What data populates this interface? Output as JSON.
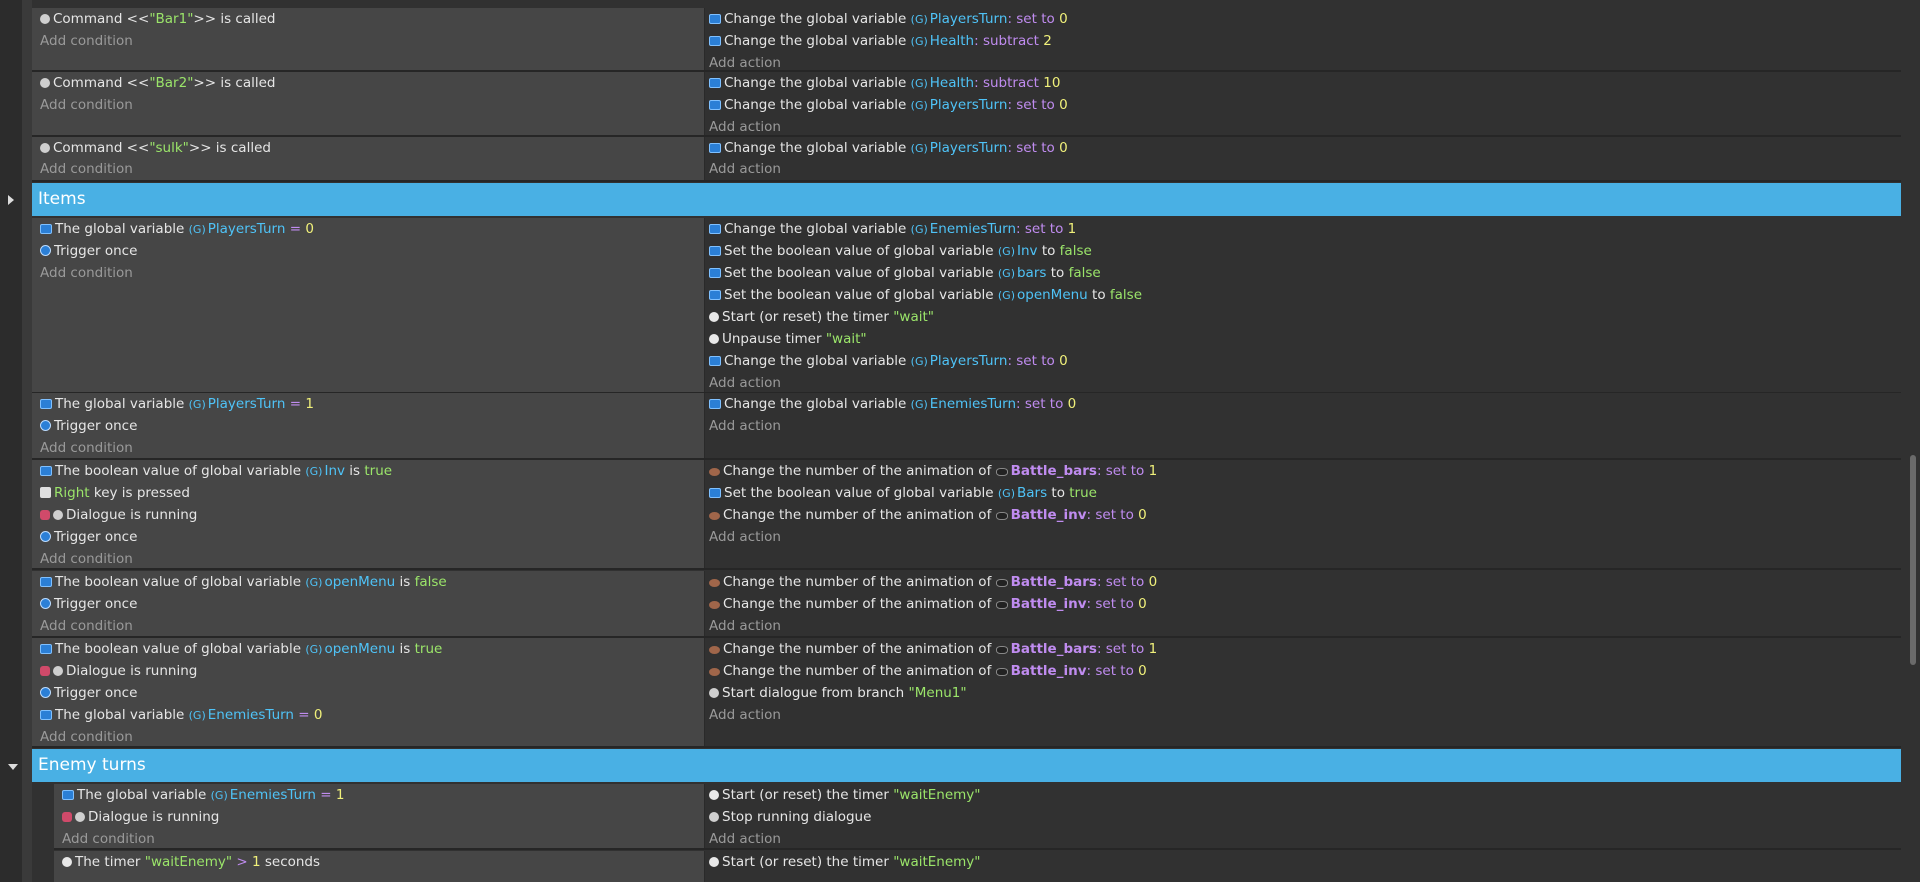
{
  "common": {
    "add_condition": "Add condition",
    "add_action": "Add action",
    "change_gv": "Change the global variable",
    "set_to": ": set to",
    "subtract": ": subtract",
    "the_gv": "The global variable",
    "trigger_once": "Trigger once",
    "bool_gv": "The boolean value of global variable",
    "set_bool": "Set the boolean value of global variable",
    "change_anim": "Change the number of the animation of",
    "is": "is",
    "to": "to",
    "dialogue_running": "Dialogue is running",
    "start_timer": "Start (or reset) the timer",
    "cmd_pre": "Command <<",
    "cmd_post": ">> is called"
  },
  "groups": {
    "items": "Items",
    "enemy_turns": "Enemy turns"
  },
  "names": {
    "PlayersTurn": "PlayersTurn",
    "Health": "Health",
    "EnemiesTurn": "EnemiesTurn",
    "Inv": "Inv",
    "bars": "bars",
    "Bars": "Bars",
    "openMenu": "openMenu",
    "Battle_bars": "Battle_bars",
    "Battle_inv": "Battle_inv"
  },
  "strings": {
    "bar1": "\"Bar1\"",
    "bar2": "\"Bar2\"",
    "sulk": "\"sulk\"",
    "wait": "\"wait\"",
    "waitEnemy": "\"waitEnemy\"",
    "menu1": "\"Menu1\"",
    "right": "Right",
    "false": "false",
    "true": "true"
  },
  "nums": {
    "zero": "0",
    "one": "1",
    "two": "2",
    "ten": "10"
  },
  "misc": {
    "unpause_timer": "Unpause timer",
    "key_pressed": "key is pressed",
    "start_dialogue": "Start dialogue from branch",
    "stop_dialogue": "Stop running dialogue",
    "eq": "=",
    "gt": ">",
    "seconds": "seconds",
    "the_timer": "The timer"
  },
  "icons": {
    "variable": "variable-icon",
    "command": "gear-icon",
    "trigger": "trigger-once-icon",
    "key": "keyboard-key-icon",
    "dialogue": "dialogue-icon",
    "animation": "animation-icon",
    "timer": "timer-icon",
    "object": "object-icon"
  }
}
